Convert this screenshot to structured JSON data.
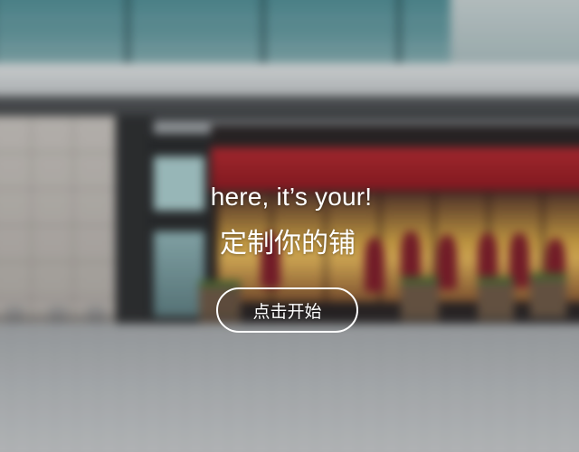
{
  "hero": {
    "tagline_en": "here, it’s your!",
    "tagline_zh": "定制你的铺",
    "start_button_label": "点击开始"
  },
  "colors": {
    "text": "#ffffff",
    "button_border": "#ffffff",
    "storefront_sign": "#a82630"
  }
}
